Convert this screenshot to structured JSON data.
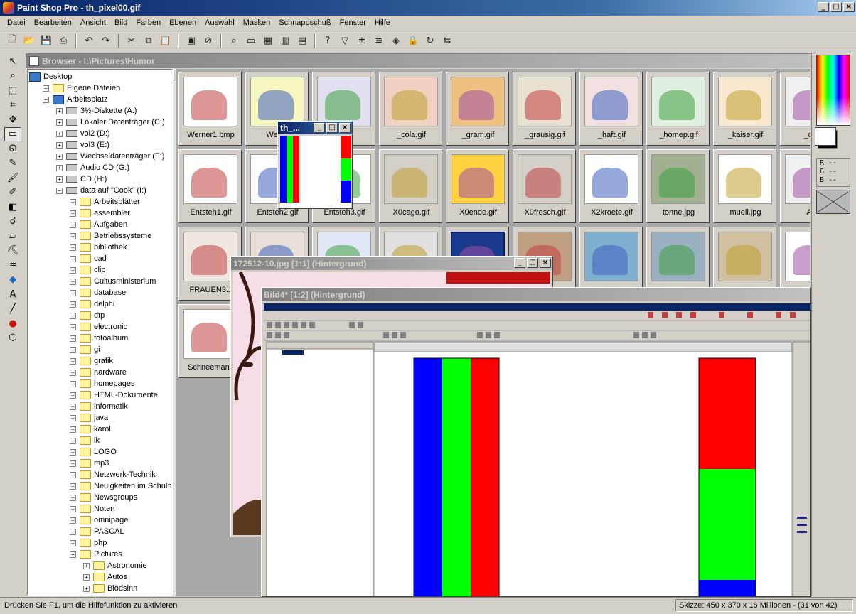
{
  "app": {
    "title": "Paint Shop Pro - th_pixel00.gif",
    "window_buttons": [
      "_",
      "□",
      "×"
    ]
  },
  "menu": [
    "Datei",
    "Bearbeiten",
    "Ansicht",
    "Bild",
    "Farben",
    "Ebenen",
    "Auswahl",
    "Masken",
    "Schnappschuß",
    "Fenster",
    "Hilfe"
  ],
  "toolbar": [
    "new-doc-icon",
    "open-folder-icon",
    "save-icon",
    "print-icon",
    "undo-icon",
    "redo-icon",
    "cut-icon",
    "copy-icon",
    "paste-icon",
    "screen-icon",
    "browse-icon",
    "zoom-icon",
    "overview-icon",
    "palette-icon",
    "histogram-icon",
    "layers-icon",
    "help-icon",
    "filter-icon",
    "plus-minus-icon",
    "levels-icon",
    "colors-icon",
    "lock-icon",
    "refresh-icon",
    "arrange-icon"
  ],
  "tools": [
    "arrow-icon",
    "zoom-icon",
    "deform-icon",
    "crop-icon",
    "move-icon",
    "selection-icon",
    "lasso-icon",
    "dropper-icon",
    "brush-icon",
    "clone-icon",
    "replace-icon",
    "retouch-icon",
    "eraser-icon",
    "tube-icon",
    "airbrush-icon",
    "fill-icon",
    "text-icon",
    "line-icon",
    "shape-icon",
    "vector-icon"
  ],
  "browser": {
    "title": "Browser - I:\\Pictures\\Humor",
    "tree": [
      {
        "label": "Desktop",
        "level": 0,
        "icon": "desktop",
        "pm": ""
      },
      {
        "label": "Eigene Dateien",
        "level": 1,
        "icon": "folder",
        "pm": "+"
      },
      {
        "label": "Arbeitsplatz",
        "level": 1,
        "icon": "desktop",
        "pm": "−"
      },
      {
        "label": "3½-Diskette (A:)",
        "level": 2,
        "icon": "drive",
        "pm": "+"
      },
      {
        "label": "Lokaler Datenträger (C:)",
        "level": 2,
        "icon": "drive",
        "pm": "+"
      },
      {
        "label": "vol2 (D:)",
        "level": 2,
        "icon": "drive",
        "pm": "+"
      },
      {
        "label": "vol3 (E:)",
        "level": 2,
        "icon": "drive",
        "pm": "+"
      },
      {
        "label": "Wechseldatenträger (F:)",
        "level": 2,
        "icon": "drive",
        "pm": "+"
      },
      {
        "label": "Audio CD (G:)",
        "level": 2,
        "icon": "drive",
        "pm": "+"
      },
      {
        "label": "CD (H:)",
        "level": 2,
        "icon": "drive",
        "pm": "+"
      },
      {
        "label": "data auf \"Cook\" (I:)",
        "level": 2,
        "icon": "drive",
        "pm": "−"
      },
      {
        "label": "Arbeitsblätter",
        "level": 3,
        "icon": "folder",
        "pm": "+"
      },
      {
        "label": "assembler",
        "level": 3,
        "icon": "folder",
        "pm": "+"
      },
      {
        "label": "Aufgaben",
        "level": 3,
        "icon": "folder",
        "pm": "+"
      },
      {
        "label": "Betriebssysteme",
        "level": 3,
        "icon": "folder",
        "pm": "+"
      },
      {
        "label": "bibliothek",
        "level": 3,
        "icon": "folder",
        "pm": "+"
      },
      {
        "label": "cad",
        "level": 3,
        "icon": "folder",
        "pm": "+"
      },
      {
        "label": "clip",
        "level": 3,
        "icon": "folder",
        "pm": "+"
      },
      {
        "label": "Cultusministerium",
        "level": 3,
        "icon": "folder",
        "pm": "+"
      },
      {
        "label": "database",
        "level": 3,
        "icon": "folder",
        "pm": "+"
      },
      {
        "label": "delphi",
        "level": 3,
        "icon": "folder",
        "pm": "+"
      },
      {
        "label": "dtp",
        "level": 3,
        "icon": "folder",
        "pm": "+"
      },
      {
        "label": "electronic",
        "level": 3,
        "icon": "folder",
        "pm": "+"
      },
      {
        "label": "fotoalbum",
        "level": 3,
        "icon": "folder",
        "pm": "+"
      },
      {
        "label": "gi",
        "level": 3,
        "icon": "folder",
        "pm": "+"
      },
      {
        "label": "grafik",
        "level": 3,
        "icon": "folder",
        "pm": "+"
      },
      {
        "label": "hardware",
        "level": 3,
        "icon": "folder",
        "pm": "+"
      },
      {
        "label": "homepages",
        "level": 3,
        "icon": "folder",
        "pm": "+"
      },
      {
        "label": "HTML-Dokumente",
        "level": 3,
        "icon": "folder",
        "pm": "+"
      },
      {
        "label": "informatik",
        "level": 3,
        "icon": "folder",
        "pm": "+"
      },
      {
        "label": "java",
        "level": 3,
        "icon": "folder",
        "pm": "+"
      },
      {
        "label": "karol",
        "level": 3,
        "icon": "folder",
        "pm": "+"
      },
      {
        "label": "lk",
        "level": 3,
        "icon": "folder",
        "pm": "+"
      },
      {
        "label": "LOGO",
        "level": 3,
        "icon": "folder",
        "pm": "+"
      },
      {
        "label": "mp3",
        "level": 3,
        "icon": "folder",
        "pm": "+"
      },
      {
        "label": "Netzwerk-Technik",
        "level": 3,
        "icon": "folder",
        "pm": "+"
      },
      {
        "label": "Neuigkeiten im Schulne",
        "level": 3,
        "icon": "folder",
        "pm": "+"
      },
      {
        "label": "Newsgroups",
        "level": 3,
        "icon": "folder",
        "pm": "+"
      },
      {
        "label": "Noten",
        "level": 3,
        "icon": "folder",
        "pm": "+"
      },
      {
        "label": "omnipage",
        "level": 3,
        "icon": "folder",
        "pm": "+"
      },
      {
        "label": "PASCAL",
        "level": 3,
        "icon": "folder",
        "pm": "+"
      },
      {
        "label": "php",
        "level": 3,
        "icon": "folder",
        "pm": "+"
      },
      {
        "label": "Pictures",
        "level": 3,
        "icon": "folder",
        "pm": "−"
      },
      {
        "label": "Astronomie",
        "level": 4,
        "icon": "folder",
        "pm": "+"
      },
      {
        "label": "Autos",
        "level": 4,
        "icon": "folder",
        "pm": "+"
      },
      {
        "label": "Blödsinn",
        "level": 4,
        "icon": "folder",
        "pm": "+"
      }
    ],
    "thumbs": [
      {
        "row": 0,
        "col": 0,
        "name": "Werner1.bmp",
        "bg": "#ffffff"
      },
      {
        "row": 0,
        "col": 1,
        "name": "Werne",
        "bg": "#f7f7c0"
      },
      {
        "row": 0,
        "col": 2,
        "name": "gif",
        "bg": "#e0e0f0"
      },
      {
        "row": 0,
        "col": 3,
        "name": "_cola.gif",
        "bg": "#f0d0c0"
      },
      {
        "row": 0,
        "col": 4,
        "name": "_gram.gif",
        "bg": "#f0c080"
      },
      {
        "row": 0,
        "col": 5,
        "name": "_grausig.gif",
        "bg": "#e8e0d0"
      },
      {
        "row": 0,
        "col": 6,
        "name": "_haft.gif",
        "bg": "#f0e0e0"
      },
      {
        "row": 0,
        "col": 7,
        "name": "_homep.gif",
        "bg": "#e0f0e0"
      },
      {
        "row": 0,
        "col": 8,
        "name": "_kaiser.gif",
        "bg": "#f8e8d0"
      },
      {
        "row": 0,
        "col": 9,
        "name": "_ons",
        "bg": "#f0f0f0"
      },
      {
        "row": 1,
        "col": 0,
        "name": "Entsteh1.gif",
        "bg": "#ffffff"
      },
      {
        "row": 1,
        "col": 1,
        "name": "Entsteh2.gif",
        "bg": "#ffffff"
      },
      {
        "row": 1,
        "col": 2,
        "name": "Entsteh3.gif",
        "bg": "#ffffff"
      },
      {
        "row": 1,
        "col": 3,
        "name": "X0cago.gif",
        "bg": "#d4d0c8"
      },
      {
        "row": 1,
        "col": 4,
        "name": "X0ende.gif",
        "bg": "#ffd040"
      },
      {
        "row": 1,
        "col": 5,
        "name": "X0frosch.gif",
        "bg": "#d4d0c8"
      },
      {
        "row": 1,
        "col": 6,
        "name": "X2kroete.gif",
        "bg": "#ffffff"
      },
      {
        "row": 1,
        "col": 7,
        "name": "tonne.jpg",
        "bg": "#a0b090"
      },
      {
        "row": 1,
        "col": 8,
        "name": "muell.jpg",
        "bg": "#ffffff"
      },
      {
        "row": 1,
        "col": 9,
        "name": "Ald",
        "bg": "#f0f0f0"
      },
      {
        "row": 2,
        "col": 0,
        "name": "FRAUEN3.J",
        "bg": "#f0e8e0"
      },
      {
        "row": 2,
        "col": 1,
        "name": "",
        "bg": "#e8e0d8"
      },
      {
        "row": 2,
        "col": 2,
        "name": "",
        "bg": "#e0e8f8"
      },
      {
        "row": 2,
        "col": 3,
        "name": "",
        "bg": "#e0e0e0"
      },
      {
        "row": 2,
        "col": 4,
        "name": "",
        "bg": "#1a3a90"
      },
      {
        "row": 2,
        "col": 5,
        "name": "",
        "bg": "#c0a080"
      },
      {
        "row": 2,
        "col": 6,
        "name": "",
        "bg": "#80b0d0"
      },
      {
        "row": 2,
        "col": 7,
        "name": "",
        "bg": "#9ab0c0"
      },
      {
        "row": 2,
        "col": 8,
        "name": "",
        "bg": "#d0c0a0"
      },
      {
        "row": 2,
        "col": 9,
        "name": "",
        "bg": "#ffffff"
      },
      {
        "row": 3,
        "col": 0,
        "name": "Schneemann",
        "bg": "#ffffff"
      }
    ]
  },
  "pixel_window": {
    "title": "th_..."
  },
  "win172": {
    "title": "172512-10.jpg [1:1] (Hintergrund)"
  },
  "bild4": {
    "title": "Bild4* [1:2] (Hintergrund)"
  },
  "palette": {
    "rgb_lines": [
      "R --",
      "G --",
      "B --"
    ]
  },
  "colors": {
    "red": "#ff0000",
    "green": "#00ff00",
    "blue": "#0000ff"
  },
  "status": {
    "help": "Drücken Sie F1, um die Hilfefunktion zu aktivieren",
    "info": "Skizze: 450 x 370 x 16 Millionen - (31 von 42)"
  }
}
